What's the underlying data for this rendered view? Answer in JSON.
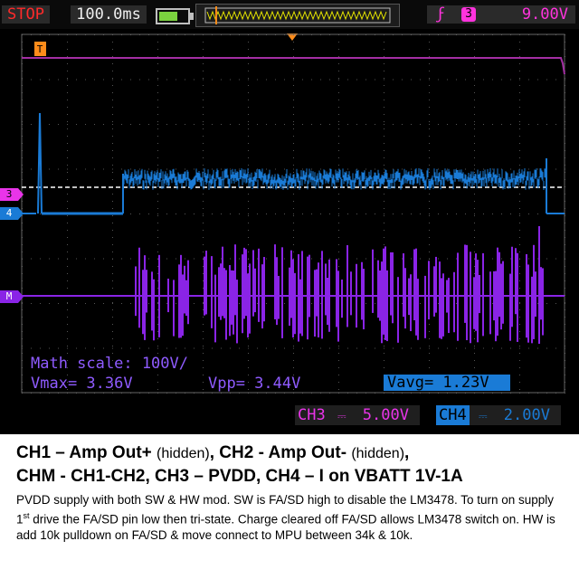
{
  "status": {
    "run_state": "STOP",
    "timebase": "100.0ms",
    "trigger_source": "3",
    "trigger_level": "9.00V",
    "trigger_position_label": "T",
    "battery_level": 0.65
  },
  "channel_markers": {
    "ch3": "3",
    "ch4": "4",
    "math": "M"
  },
  "measurements": {
    "math_scale": "Math scale: 100V/",
    "vmax": "Vmax= 3.36V",
    "vpp": "Vpp= 3.44V",
    "vavg": "Vavg= 1.23V"
  },
  "channel_scales": {
    "ch3_label": "CH3",
    "ch3_value": "5.00V",
    "ch4_label": "CH4",
    "ch4_value": "2.00V"
  },
  "caption": {
    "line1_a": "CH1 – Amp Out+",
    "line1_b": "(hidden)",
    "line1_c": ", CH2 - Amp Out-",
    "line1_d": "(hidden)",
    "line1_e": ",",
    "line2": "CHM - CH1-CH2, CH3 – PVDD, CH4 – I on VBATT 1V-1A",
    "body_a": "PVDD supply with both SW & HW mod. SW is FA/SD high to disable the LM3478. To turn on supply 1",
    "body_sup": "st",
    "body_b": " drive the FA/SD pin low then tri-state. Charge cleared off FA/SD allows LM3478 switch on. HW is add 10k pulldown on FA/SD & move connect to MPU between 34k & 10k."
  },
  "colors": {
    "ch3": "#e934e9",
    "ch4": "#1a7bd6",
    "math": "#8a24e6",
    "trigger": "#ff8c1a",
    "trace_ch3": "#a32ea3"
  }
}
